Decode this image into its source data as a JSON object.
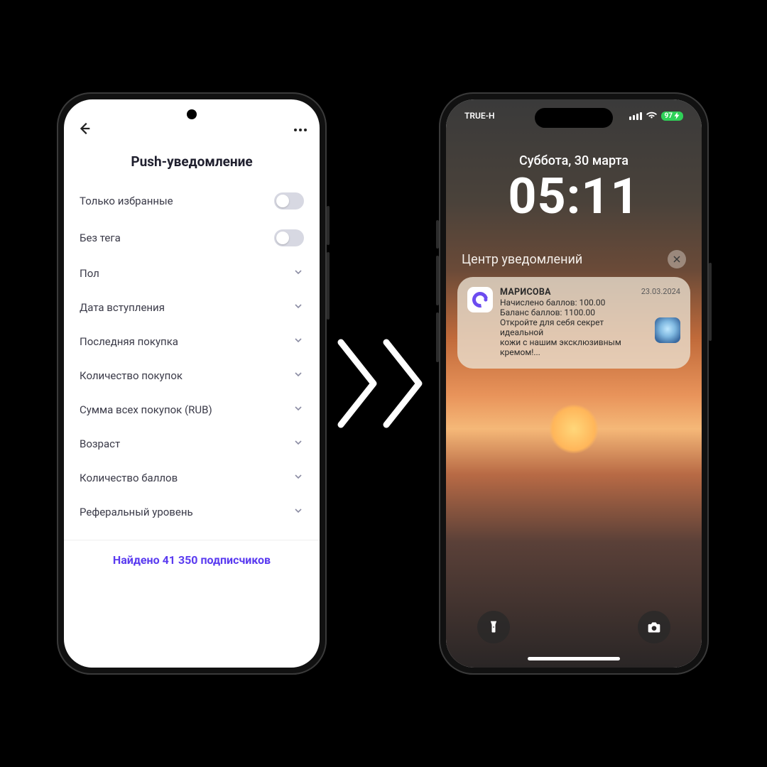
{
  "left": {
    "title": "Push-уведомление",
    "toggles": [
      {
        "label": "Только избранные"
      },
      {
        "label": "Без тега"
      }
    ],
    "filters": [
      {
        "label": "Пол"
      },
      {
        "label": "Дата вступления"
      },
      {
        "label": "Последняя покупка"
      },
      {
        "label": "Количество покупок"
      },
      {
        "label": "Сумма всех покупок (RUB)"
      },
      {
        "label": "Возраст"
      },
      {
        "label": "Количество баллов"
      },
      {
        "label": "Реферальный уровень"
      }
    ],
    "found": "Найдено 41 350 подписчиков"
  },
  "right": {
    "carrier": "TRUE-H",
    "battery": "97",
    "date": "Суббота, 30 марта",
    "time": "05:11",
    "nc_title": "Центр уведомлений",
    "notif": {
      "app": "МАРИСОВА",
      "when": "23.03.2024",
      "line1": "Начислено баллов: 100.00",
      "line2": "Баланс баллов: 1100.00",
      "line3": "Откройте для себя секрет идеальной",
      "line4": "кожи с нашим эксклюзивным кремом!..."
    }
  }
}
